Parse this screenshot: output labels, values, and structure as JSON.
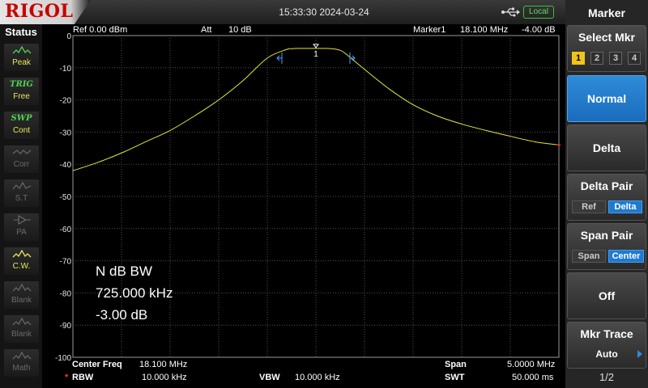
{
  "brand": "RIGOL",
  "datetime": "15:33:30 2024-03-24",
  "local_badge": "Local",
  "status": {
    "title": "Status",
    "items": [
      {
        "name": "peak",
        "symbol": "",
        "label": "Peak",
        "active": true
      },
      {
        "name": "trig",
        "symbol": "TRIG",
        "label": "Free",
        "active": true
      },
      {
        "name": "swp",
        "symbol": "SWP",
        "label": "Cont",
        "active": true
      },
      {
        "name": "corr",
        "symbol": "",
        "label": "Corr",
        "active": false
      },
      {
        "name": "st",
        "symbol": "",
        "label": "S.T",
        "active": false
      },
      {
        "name": "pa",
        "symbol": "",
        "label": "PA",
        "active": false
      },
      {
        "name": "cw",
        "symbol": "",
        "label": "C.W.",
        "active": true
      },
      {
        "name": "blank1",
        "symbol": "",
        "label": "Blank",
        "active": false
      },
      {
        "name": "blank2",
        "symbol": "",
        "label": "Blank",
        "active": false
      },
      {
        "name": "math",
        "symbol": "",
        "label": "Math",
        "active": false
      }
    ]
  },
  "header": {
    "ref": "Ref  0.00 dBm",
    "att_label": "Att",
    "att_value": "10 dB",
    "marker_label": "Marker1",
    "marker_freq": "18.100 MHz",
    "marker_amp": "-4.00 dB"
  },
  "chart_data": {
    "type": "line",
    "ylabel": "",
    "xlabel": "",
    "ylim": [
      -100,
      0
    ],
    "yticks": [
      "0",
      "-10",
      "-20",
      "-30",
      "-40",
      "-50",
      "-60",
      "-70",
      "-80",
      "-90",
      "-100"
    ],
    "x": [
      15.6,
      15.85,
      16.1,
      16.35,
      16.6,
      16.85,
      17.1,
      17.35,
      17.6,
      17.8,
      17.85,
      17.9,
      18.0,
      18.1,
      18.2,
      18.3,
      18.35,
      18.4,
      18.6,
      18.85,
      19.1,
      19.35,
      19.6,
      19.85,
      20.1,
      20.35,
      20.6
    ],
    "series": [
      {
        "values": [
          -42,
          -39.5,
          -36.5,
          -33,
          -29.5,
          -25,
          -20,
          -14,
          -7,
          -4.3,
          -4.1,
          -4,
          -4,
          -4,
          -4,
          -4.2,
          -4.6,
          -5.5,
          -10.5,
          -16.5,
          -21.5,
          -25,
          -27.5,
          -29.5,
          -31.3,
          -33,
          -34
        ]
      }
    ],
    "marker": {
      "label": "1",
      "x": 18.1,
      "y": -4.0
    },
    "bw_markers": [
      {
        "x": 17.75,
        "y": -7.0
      },
      {
        "x": 18.45,
        "y": -7.0
      }
    ],
    "grid": true,
    "trace_color": "#e6e639"
  },
  "ndb": {
    "title": "N dB BW",
    "bandwidth": "725.000 kHz",
    "level": "-3.00 dB"
  },
  "footer": {
    "center_freq_label": "Center Freq",
    "center_freq_value": "18.100 MHz",
    "span_label": "Span",
    "span_value": "5.0000 MHz",
    "rbw_star": "*",
    "rbw_label": "RBW",
    "rbw_value": "10.000 kHz",
    "vbw_label": "VBW",
    "vbw_value": "10.000 kHz",
    "swt_label": "SWT",
    "swt_value": "50.000 ms"
  },
  "menu": {
    "title": "Marker",
    "select_mkr": {
      "label": "Select Mkr",
      "options": [
        "1",
        "2",
        "3",
        "4"
      ],
      "selected": "1"
    },
    "normal": "Normal",
    "delta": "Delta",
    "delta_pair": {
      "label": "Delta Pair",
      "options": [
        "Ref",
        "Delta"
      ],
      "selected": "Delta"
    },
    "span_pair": {
      "label": "Span Pair",
      "options": [
        "Span",
        "Center"
      ],
      "selected": "Center"
    },
    "off": "Off",
    "mkr_trace": {
      "label": "Mkr Trace",
      "value": "Auto"
    },
    "page": "1/2"
  },
  "colors": {
    "accent": "#1f7ad0",
    "trace": "#e6e639",
    "brand_red": "#c80000",
    "local_green": "#3fbf3f"
  }
}
